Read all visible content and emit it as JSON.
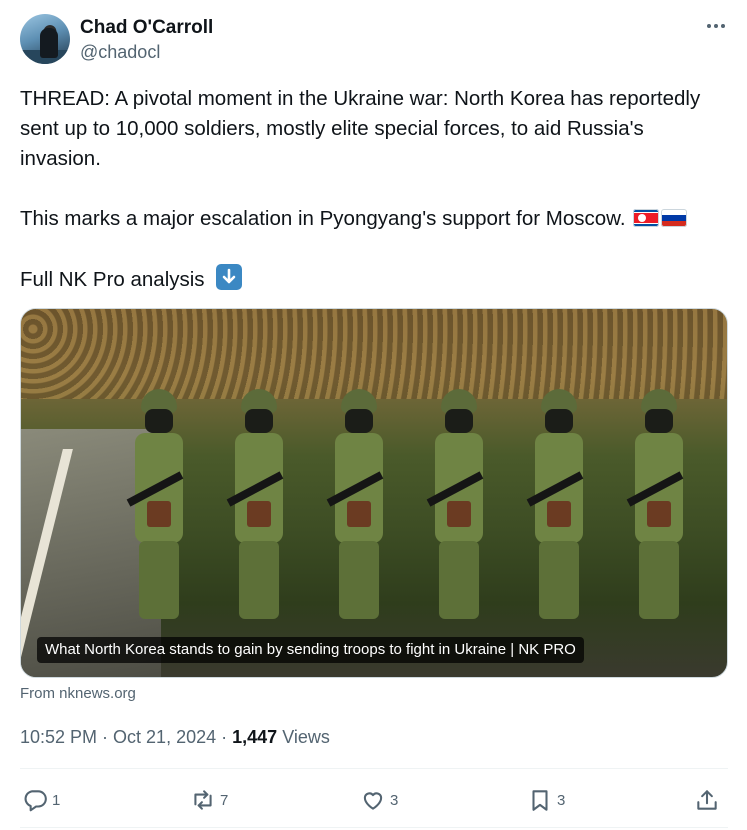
{
  "author": {
    "display_name": "Chad O'Carroll",
    "handle": "@chadocl"
  },
  "tweet": {
    "line1": "THREAD: A pivotal moment in the Ukraine war: North Korea has reportedly sent up to 10,000 soldiers, mostly elite special forces, to aid Russia's invasion.",
    "line2": "This marks a major escalation in Pyongyang's support for Moscow.",
    "line3": "Full NK Pro analysis"
  },
  "card": {
    "caption": "What North Korea stands to gain by sending troops to fight in Ukraine | NK PRO",
    "source": "From nknews.org"
  },
  "meta": {
    "time": "10:52 PM",
    "separator": " · ",
    "date": "Oct 21, 2024",
    "views_count": "1,447",
    "views_label": "Views"
  },
  "actions": {
    "replies": "1",
    "reposts": "7",
    "likes": "3",
    "bookmarks": "3"
  },
  "icons": {
    "more": "more-icon",
    "flag1": "north-korea-flag-icon",
    "flag2": "russia-flag-icon",
    "arrow": "down-arrow-icon",
    "reply": "reply-icon",
    "repost": "repost-icon",
    "like": "heart-icon",
    "bookmark": "bookmark-icon",
    "share": "share-icon"
  },
  "colors": {
    "text": "#0f1419",
    "secondary": "#536471",
    "border": "#cfd9de"
  }
}
